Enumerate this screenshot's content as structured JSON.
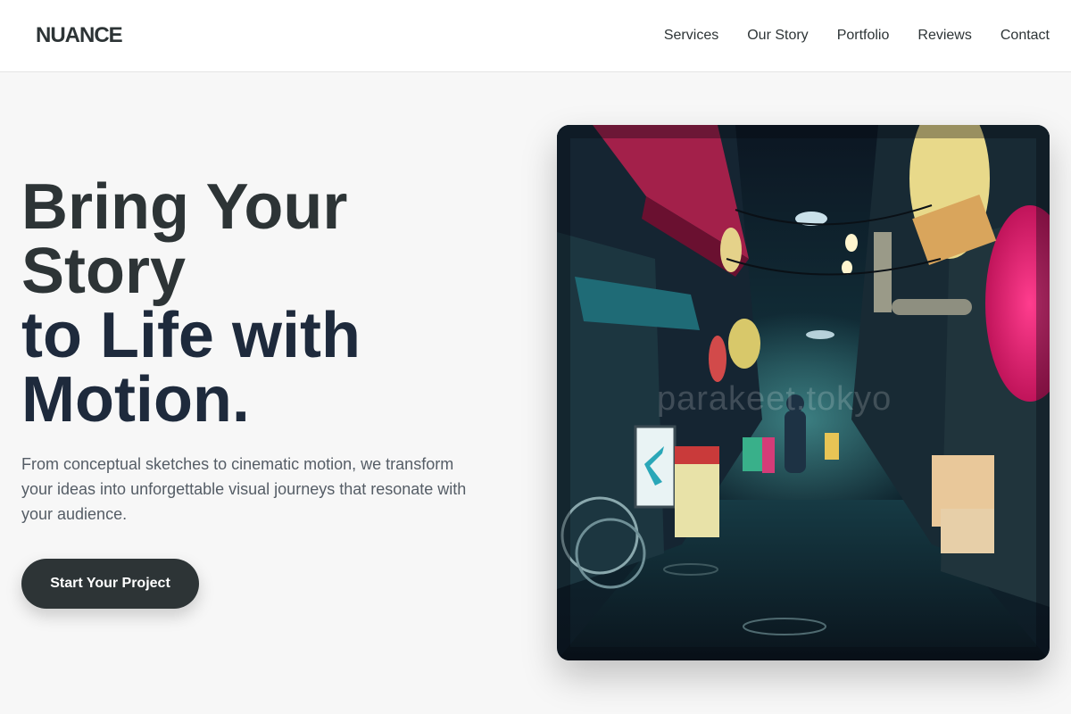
{
  "brand": {
    "logo_text": "NUANCE"
  },
  "nav": {
    "items": [
      {
        "label": "Services"
      },
      {
        "label": "Our Story"
      },
      {
        "label": "Portfolio"
      },
      {
        "label": "Reviews"
      },
      {
        "label": "Contact"
      }
    ]
  },
  "hero": {
    "headline_line1": "Bring Your",
    "headline_line2": "Story",
    "headline_line3": "to Life with",
    "headline_line4": "Motion.",
    "subtext": "From conceptual sketches to cinematic motion, we transform your ideas into unforgettable visual journeys that resonate with your audience.",
    "cta_label": "Start Your Project",
    "image_watermark": "parakeet.tokyo",
    "image_subject": "neon-lit-tokyo-alley"
  },
  "colors": {
    "text_dark": "#2d3436",
    "headline_navy": "#1e2a3c",
    "subtext_gray": "#555d66",
    "page_bg": "#f7f7f7",
    "button_bg": "#2d3436"
  }
}
